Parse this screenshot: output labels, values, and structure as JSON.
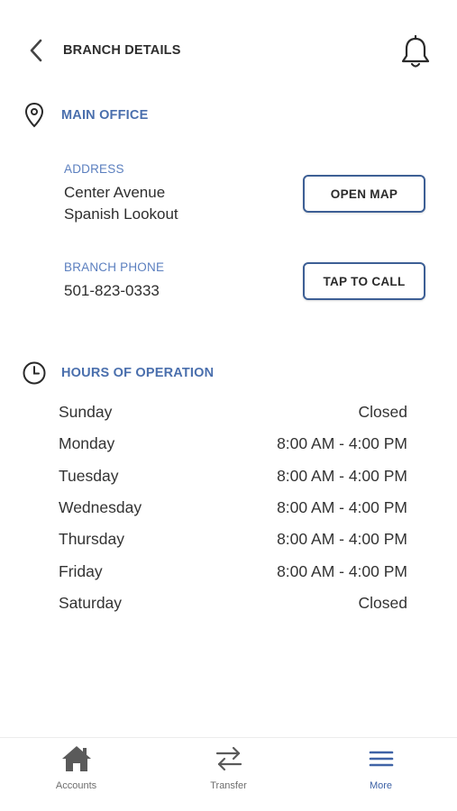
{
  "header": {
    "title": "BRANCH DETAILS",
    "back_icon": "chevron-left-icon",
    "bell_icon": "bell-icon"
  },
  "main_office": {
    "title": "MAIN OFFICE",
    "icon": "location-pin-icon",
    "address_label": "ADDRESS",
    "address_line1": "Center Avenue",
    "address_line2": "Spanish Lookout",
    "open_map_label": "OPEN MAP",
    "phone_label": "BRANCH PHONE",
    "phone_value": "501-823-0333",
    "call_label": "TAP TO CALL"
  },
  "hours": {
    "title": "HOURS OF OPERATION",
    "icon": "clock-icon",
    "rows": [
      {
        "day": "Sunday",
        "time": "Closed"
      },
      {
        "day": "Monday",
        "time": "8:00 AM - 4:00 PM"
      },
      {
        "day": "Tuesday",
        "time": "8:00 AM - 4:00 PM"
      },
      {
        "day": "Wednesday",
        "time": "8:00 AM - 4:00 PM"
      },
      {
        "day": "Thursday",
        "time": "8:00 AM - 4:00 PM"
      },
      {
        "day": "Friday",
        "time": "8:00 AM - 4:00 PM"
      },
      {
        "day": "Saturday",
        "time": "Closed"
      }
    ]
  },
  "tabbar": {
    "items": [
      {
        "label": "Accounts",
        "icon": "house-icon",
        "active": false
      },
      {
        "label": "Transfer",
        "icon": "transfer-arrows-icon",
        "active": false
      },
      {
        "label": "More",
        "icon": "menu-icon",
        "active": true
      }
    ]
  },
  "colors": {
    "accent": "#4a6fad",
    "button_border": "#3d5f95",
    "active_tab": "#3f63a6"
  }
}
